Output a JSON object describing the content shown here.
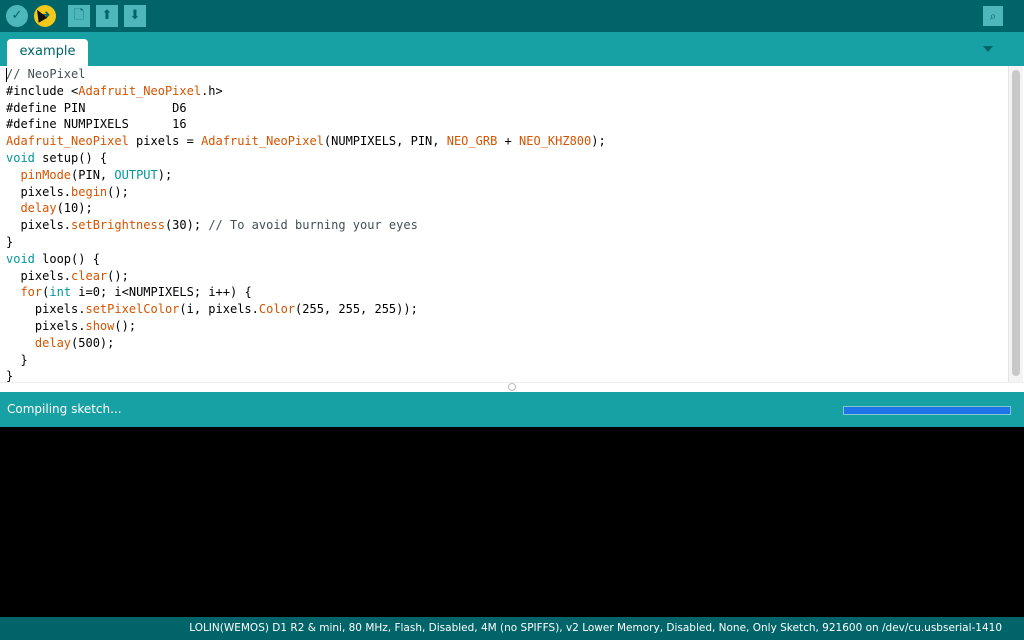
{
  "toolbar": {
    "verify_icon": "check-icon",
    "upload_icon": "arrow-right-icon",
    "new_icon": "document-icon",
    "open_icon": "arrow-up-icon",
    "save_icon": "arrow-down-icon",
    "serial_monitor_icon": "magnifier-icon"
  },
  "tabs": [
    {
      "label": "example"
    }
  ],
  "editor": {
    "lines": [
      [
        {
          "t": "// NeoPixel",
          "c": "cm"
        }
      ],
      [
        {
          "t": "#include <"
        },
        {
          "t": "Adafruit_NeoPixel",
          "c": "fn"
        },
        {
          "t": ".h>"
        }
      ],
      [
        {
          "t": "#define PIN            D6"
        }
      ],
      [
        {
          "t": "#define NUMPIXELS      16"
        }
      ],
      [
        {
          "t": "Adafruit_NeoPixel",
          "c": "fn"
        },
        {
          "t": " pixels = "
        },
        {
          "t": "Adafruit_NeoPixel",
          "c": "fn"
        },
        {
          "t": "(NUMPIXELS, PIN, "
        },
        {
          "t": "NEO_GRB",
          "c": "fn"
        },
        {
          "t": " + "
        },
        {
          "t": "NEO_KHZ800",
          "c": "fn"
        },
        {
          "t": ");"
        }
      ],
      [
        {
          "t": "void",
          "c": "kw"
        },
        {
          "t": " setup() {"
        }
      ],
      [
        {
          "t": "  "
        },
        {
          "t": "pinMode",
          "c": "fn"
        },
        {
          "t": "(PIN, "
        },
        {
          "t": "OUTPUT",
          "c": "kw"
        },
        {
          "t": ");"
        }
      ],
      [
        {
          "t": "  pixels."
        },
        {
          "t": "begin",
          "c": "fn"
        },
        {
          "t": "();"
        }
      ],
      [
        {
          "t": "  "
        },
        {
          "t": "delay",
          "c": "fn"
        },
        {
          "t": "(10);"
        }
      ],
      [
        {
          "t": "  pixels."
        },
        {
          "t": "setBrightness",
          "c": "fn"
        },
        {
          "t": "(30); "
        },
        {
          "t": "// To avoid burning your eyes",
          "c": "cm"
        }
      ],
      [
        {
          "t": "}"
        }
      ],
      [
        {
          "t": "void",
          "c": "kw"
        },
        {
          "t": " loop() {"
        }
      ],
      [
        {
          "t": "  pixels."
        },
        {
          "t": "clear",
          "c": "fn"
        },
        {
          "t": "();"
        }
      ],
      [
        {
          "t": "  "
        },
        {
          "t": "for",
          "c": "fn"
        },
        {
          "t": "("
        },
        {
          "t": "int",
          "c": "kw"
        },
        {
          "t": " i=0; i<NUMPIXELS; i++) {"
        }
      ],
      [
        {
          "t": "    pixels."
        },
        {
          "t": "setPixelColor",
          "c": "fn"
        },
        {
          "t": "(i, pixels."
        },
        {
          "t": "Color",
          "c": "fn"
        },
        {
          "t": "(255, 255, 255));"
        }
      ],
      [
        {
          "t": "    pixels."
        },
        {
          "t": "show",
          "c": "fn"
        },
        {
          "t": "();"
        }
      ],
      [
        {
          "t": "    "
        },
        {
          "t": "delay",
          "c": "fn"
        },
        {
          "t": "(500);"
        }
      ],
      [
        {
          "t": "  }"
        }
      ],
      [
        {
          "t": "}"
        }
      ]
    ]
  },
  "status": {
    "text": "Compiling sketch...",
    "progress": 1.0
  },
  "footer": {
    "board_info": "LOLIN(WEMOS) D1 R2 & mini, 80 MHz, Flash, Disabled, 4M (no SPIFFS), v2 Lower Memory, Disabled, None, Only Sketch, 921600 on /dev/cu.usbserial-1410"
  },
  "colors": {
    "toolbar_bg": "#006468",
    "tabbar_bg": "#17a1a5",
    "keyword": "#00979c",
    "function": "#d35400",
    "comment": "#434f54",
    "progress": "#1d74e8"
  }
}
